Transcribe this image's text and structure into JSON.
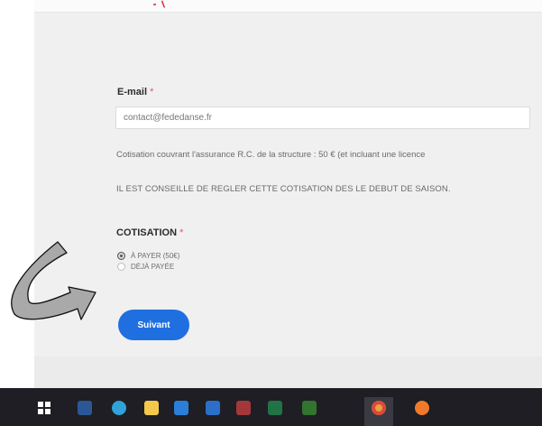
{
  "form": {
    "email_label": "E-mail",
    "required_mark": "*",
    "email_value": "contact@fededanse.fr",
    "info_line_1": "Cotisation couvrant l'assurance R.C. de la structure : 50 € (et incluant une licence",
    "info_line_2": "IL EST CONSEILLE DE REGLER CETTE COTISATION DES LE DEBUT DE SAISON.",
    "cotisation_label": "COTISATION",
    "options": [
      {
        "label": "À PAYER (50€)",
        "checked": true
      },
      {
        "label": "DÉJÀ PAYÉE",
        "checked": false
      }
    ],
    "next_button": "Suivant"
  },
  "colors": {
    "accent": "#1f6fe0",
    "required": "#e05a5a",
    "background": "#f0f0f1",
    "taskbar": "#1e1e24"
  },
  "taskbar": {
    "icons": [
      "windows-start-icon",
      "word-icon",
      "edge-icon",
      "file-explorer-icon",
      "mail-icon",
      "calendar-icon",
      "access-icon",
      "excel-icon",
      "project-icon",
      "chrome-icon",
      "firefox-icon"
    ]
  }
}
